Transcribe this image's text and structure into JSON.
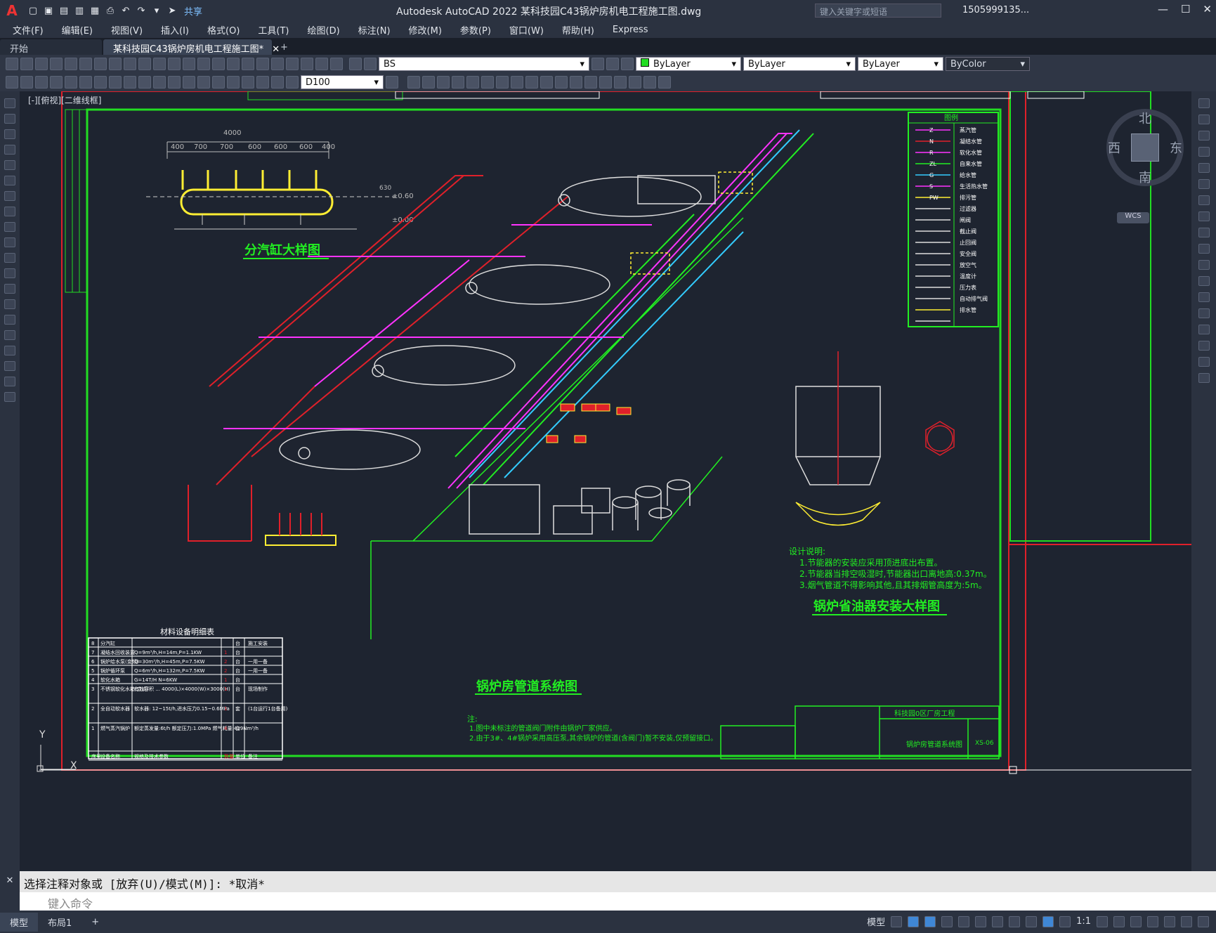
{
  "app": {
    "logo": "A",
    "window_title": "Autodesk AutoCAD 2022    某科技园C43锅炉房机电工程施工图.dwg",
    "share_label": "共享",
    "search_placeholder": "键入关键字或短语",
    "user_label": "1505999135...",
    "window_buttons": [
      "—",
      "☐",
      "✕"
    ]
  },
  "menu": [
    "文件(F)",
    "编辑(E)",
    "视图(V)",
    "插入(I)",
    "格式(O)",
    "工具(T)",
    "绘图(D)",
    "标注(N)",
    "修改(M)",
    "参数(P)",
    "窗口(W)",
    "帮助(H)",
    "Express"
  ],
  "tabs": [
    {
      "label": "开始",
      "active": false
    },
    {
      "label": "某科技园C43锅炉房机电工程施工图*",
      "active": true
    }
  ],
  "tab_close": "✕",
  "tab_add": "+",
  "toolbar": {
    "layer_combo": "BS",
    "color_combo": "ByLayer",
    "linetype_combo": "ByLayer",
    "lineweight_combo": "ByLayer",
    "plotstyle_combo": "ByColor",
    "dimstyle_combo": "D100"
  },
  "viewport_label": "[-][俯视][二维线框]",
  "viewcube": {
    "north": "北",
    "south": "南",
    "west": "西",
    "east": "东",
    "wcs": "WCS"
  },
  "drawing": {
    "header_boiler_detail": "分汽缸大样图",
    "dim_total": "4000",
    "dim_segments": [
      "400",
      "700",
      "700",
      "600",
      "600",
      "600",
      "400"
    ],
    "elev_1": "±0.60",
    "elev_2": "±0.00",
    "dim_side": "630",
    "system_title": "锅炉房管道系统图",
    "economizer_title": "锅炉省油器安装大样图",
    "legend_title": "图例",
    "legend_codes": [
      "Z",
      "N",
      "R",
      "ZL",
      "G",
      "S",
      "PW",
      "",
      "",
      "",
      "",
      "",
      "",
      "",
      "",
      "",
      "",
      ""
    ],
    "legend_names": [
      "蒸汽管",
      "凝结水管",
      "软化水管",
      "自来水管",
      "给水管",
      "生活热水管",
      "排污管",
      "过滤器",
      "闸阀",
      "截止阀",
      "止回阀",
      "安全阀",
      "放空气",
      "温度计",
      "压力表",
      "自动排气阀",
      "排水管",
      ""
    ],
    "design_notes_title": "设计说明:",
    "design_notes": [
      "1.节能器的安装应采用顶进底出布置。",
      "2.节能器当排空吸湿时,节能器出口离地高:0.37m。",
      "3.烟气管道不得影响其他,且其排烟管高度为:5m。"
    ],
    "table_title": "材料设备明细表",
    "table_rows": [
      [
        "8",
        "分汽缸",
        "",
        "",
        "台",
        "施工安装"
      ],
      [
        "7",
        "凝结水回收装置",
        "Q=9m³/h,H=14m,P=1.1KW",
        "1",
        "台",
        ""
      ],
      [
        "6",
        "锅炉给水泵(变频)",
        "Q=30m³/h,H=45m,P=7.5KW",
        "2",
        "台",
        "一用一备"
      ],
      [
        "5",
        "锅炉循环泵",
        "Q=6m³/h,H=132m,P=7.5KW",
        "2",
        "台",
        "一用一备"
      ],
      [
        "4",
        "软化水箱",
        "G=14T/H  N=6KW",
        "1",
        "台",
        ""
      ],
      [
        "3",
        "不锈钢软化水箱(立式)",
        "有效容积 ... 4000(L)×4000(W)×3000(H)",
        "1",
        "台",
        "现场制作"
      ],
      [
        "2",
        "全自动软水器",
        "软水器: 12~15t/h,进水压力0.15~0.6MPa",
        "1",
        "套",
        "(1台运行1台备用)"
      ],
      [
        "1",
        "燃气蒸汽锅炉",
        "额定蒸发量:6t/h  额定压力:1.0MPa  燃气耗量:429Nm³/h",
        "4",
        "台",
        ""
      ]
    ],
    "table_header": [
      "序号",
      "设备名称",
      "规格及技术参数",
      "数量",
      "单位",
      "备注"
    ],
    "system_notes_label": "注:",
    "system_notes": [
      "1.图中未标注的管道阀门附件由锅炉厂家供应。",
      "2.由于3#、4#锅炉采用高压泵,其余锅炉的管道(含阀门)暂不安装,仅预留接口。"
    ],
    "titleblock_project": "科技园0区厂房工程",
    "titleblock_sheet": "锅炉房管道系统图",
    "titleblock_number": "XS-06",
    "ucs_y": "Y",
    "ucs_x": "X"
  },
  "command": {
    "prompt": "选择注释对象或 [放弃(U)/模式(M)]: *取消*",
    "input_placeholder": "键入命令"
  },
  "status": {
    "tabs": [
      "模型",
      "布局1"
    ],
    "add": "+",
    "model_label": "模型",
    "scale": "1:1"
  }
}
